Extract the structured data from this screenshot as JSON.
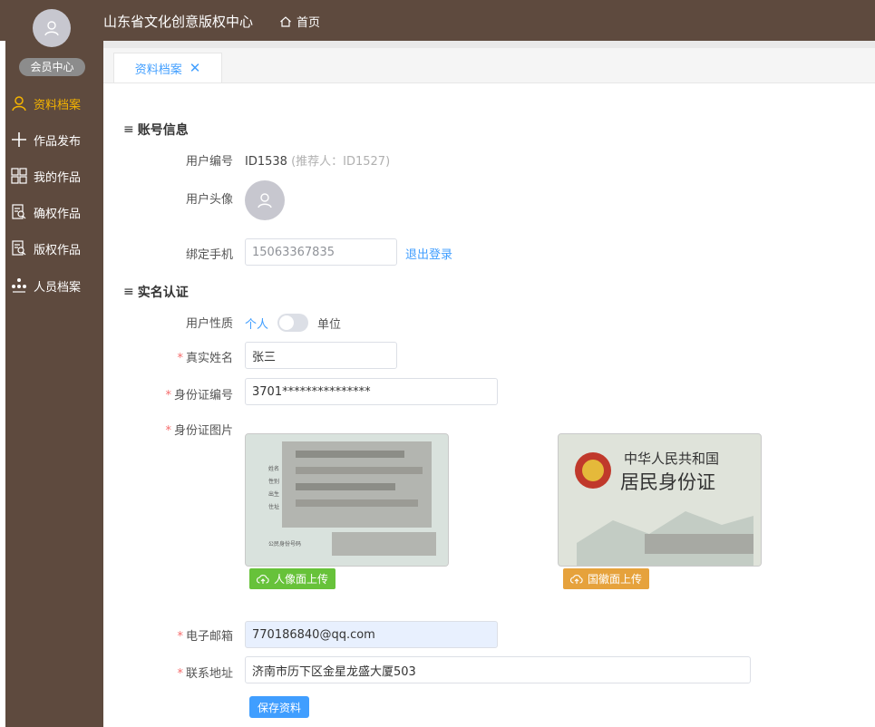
{
  "header": {
    "title": "山东省文化创意版权中心",
    "home_label": "首页"
  },
  "sidebar": {
    "member_center": "会员中心",
    "items": [
      {
        "label": "资料档案",
        "icon": "user-icon"
      },
      {
        "label": "作品发布",
        "icon": "plus-icon"
      },
      {
        "label": "我的作品",
        "icon": "grid-icon"
      },
      {
        "label": "确权作品",
        "icon": "document-search-icon"
      },
      {
        "label": "版权作品",
        "icon": "document-search-icon"
      },
      {
        "label": "人员档案",
        "icon": "org-chart-icon"
      }
    ]
  },
  "tabs": [
    {
      "label": "资料档案",
      "close": "✕"
    }
  ],
  "account": {
    "section_title": "账号信息",
    "user_id_label": "用户编号",
    "user_id": "ID1538",
    "referrer": "(推荐人：ID1527)",
    "avatar_label": "用户头像",
    "phone_label": "绑定手机",
    "phone": "15063367835",
    "logout": "退出登录"
  },
  "realname": {
    "section_title": "实名认证",
    "type_label": "用户性质",
    "type_personal": "个人",
    "type_company": "单位",
    "name_label": "真实姓名",
    "name_value": "张三",
    "id_label": "身份证编号",
    "id_value": "3701***************",
    "idpic_label": "身份证图片",
    "card_back_line1": "中华人民共和国",
    "card_back_line2": "居民身份证",
    "upload_front": "人像面上传",
    "upload_back": "国徽面上传",
    "email_label": "电子邮箱",
    "email_value": "770186840@qq.com",
    "address_label": "联系地址",
    "address_value": "济南市历下区金星龙盛大厦503",
    "save": "保存资料",
    "required_mark": "*"
  },
  "colors": {
    "sidebar": "#5e4a3e",
    "accent": "#409eff",
    "active": "#f5b400",
    "green": "#67c23a",
    "orange": "#e6a23c"
  }
}
